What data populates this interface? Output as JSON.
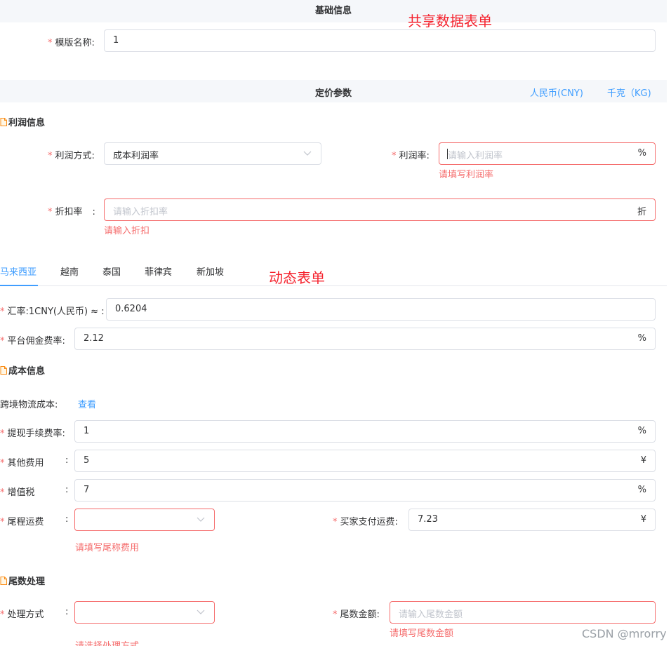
{
  "basic_section": {
    "title": "基础信息"
  },
  "annotations": {
    "shared": "共享数据表单",
    "dynamic": "动态表单"
  },
  "template": {
    "label": "模版名称:",
    "value": "1"
  },
  "pricing_section": {
    "title": "定价参数",
    "currency": "人民币(CNY)",
    "weight": "千克（KG)"
  },
  "profit": {
    "heading": "利润信息",
    "method_label": "利润方式:",
    "method_value": "成本利润率",
    "rate_label": "利润率:",
    "rate_placeholder": "请输入利润率",
    "rate_suffix": "%",
    "rate_error": "请填写利润率",
    "discount_label": "折扣率",
    "discount_colon": ":",
    "discount_placeholder": "请输入折扣率",
    "discount_suffix": "折",
    "discount_error": "请输入折扣"
  },
  "tabs": [
    "马来西亚",
    "越南",
    "泰国",
    "菲律宾",
    "新加坡"
  ],
  "rates": {
    "exchange_label": "汇率:1CNY(人民币) ≈ :",
    "exchange_value": "0.6204",
    "commission_label": "平台佣金费率:",
    "commission_value": "2.12",
    "commission_suffix": "%"
  },
  "cost": {
    "heading": "成本信息",
    "logistics_label": "跨境物流成本:",
    "logistics_link": "查看",
    "withdraw_label": "提现手续费率:",
    "withdraw_value": "1",
    "withdraw_suffix": "%",
    "other_label": "其他费用",
    "other_value": "5",
    "other_suffix": "¥",
    "vat_label": "增值税",
    "vat_value": "7",
    "vat_suffix": "%",
    "tail_label": "尾程运费",
    "tail_error": "请填写尾称费用",
    "buyer_label": "买家支付运费:",
    "buyer_value": "7.23",
    "buyer_suffix": "¥",
    "colon": ":"
  },
  "rounding": {
    "heading": "尾数处理",
    "method_label": "处理方式",
    "method_error": "请选择处理方式",
    "amount_label": "尾数金额:",
    "amount_placeholder": "请输入尾数金额",
    "amount_error": "请填写尾数金额"
  },
  "watermark": "CSDN @mrorry",
  "colors": {
    "accent": "#409eff",
    "error": "#f56c6c",
    "annotation": "#f5222d",
    "section_bg": "#f5f7fa"
  }
}
